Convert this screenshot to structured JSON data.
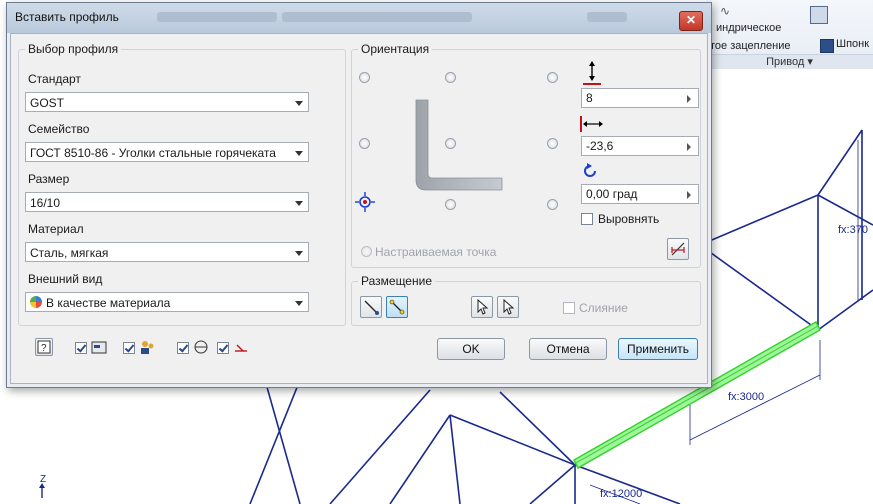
{
  "dialog": {
    "title": "Вставить профиль",
    "close_glyph": "✕"
  },
  "profile_selection": {
    "legend": "Выбор профиля",
    "standard_label": "Стандарт",
    "standard_value": "GOST",
    "family_label": "Семейство",
    "family_value": "ГОСТ 8510-86 - Уголки стальные горячеката",
    "size_label": "Размер",
    "size_value": "16/10",
    "material_label": "Материал",
    "material_value": "Сталь, мягкая",
    "appearance_label": "Внешний вид",
    "appearance_value": "В качестве материала"
  },
  "orientation": {
    "legend": "Ориентация",
    "offset_v_value": "8",
    "offset_h_value": "-23,6",
    "rotation_value": "0,00 град",
    "align_label": "Выровнять",
    "custom_point_label": "Настраиваемая точка"
  },
  "placement": {
    "legend": "Размещение",
    "merge_label": "Слияние"
  },
  "buttons": {
    "ok": "OK",
    "cancel": "Отмена",
    "apply": "Применить"
  },
  "ribbon": {
    "item1": "индрическое",
    "item2": "тое зацепление",
    "item3": "Шпонк",
    "group": "Привод ▾"
  },
  "canvas": {
    "dim1": "fx:370",
    "dim2": "fx:3000",
    "dim3": "fx:12000",
    "axis_z": "Z"
  },
  "colors": {
    "frame": "#1a2a8c",
    "highlight": "#31d22a",
    "accent_red": "#c0141c",
    "accent_blue": "#1a3cd8"
  }
}
